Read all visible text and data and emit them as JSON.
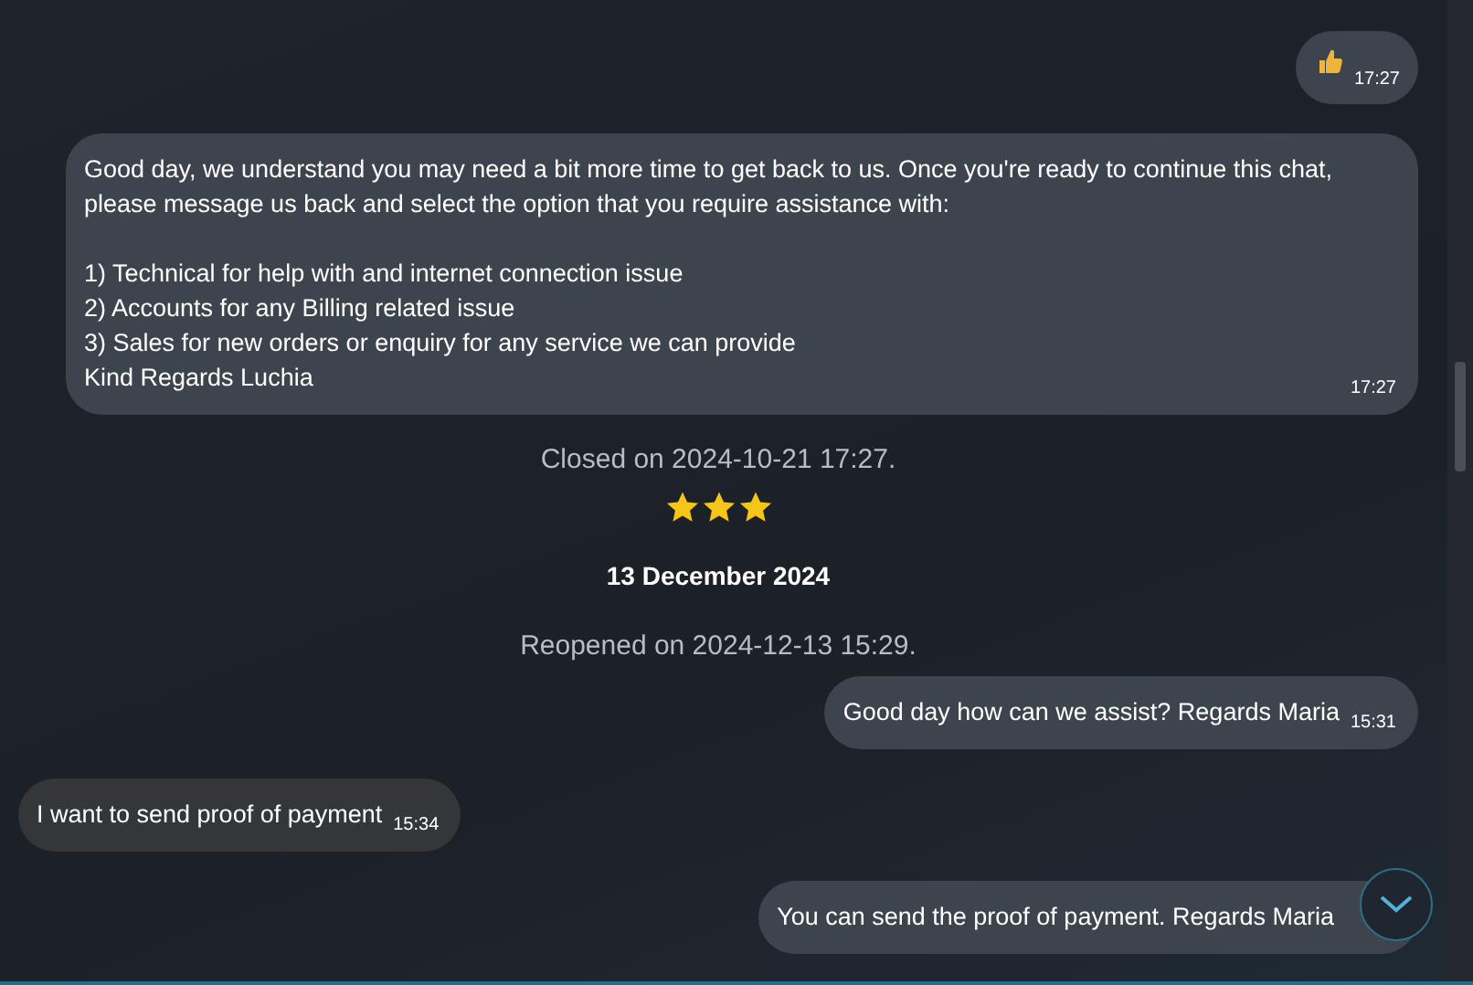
{
  "messages": [
    {
      "kind": "thumbs_up",
      "outgoing": true,
      "time": "17:27"
    },
    {
      "kind": "text",
      "outgoing": true,
      "text": "Good day, we understand you may need a bit more time to get back to us. Once you're ready to continue this chat, please message us back and select the option that you require assistance with:\n\n1) Technical for help with and internet connection issue\n2) Accounts for any Billing related issue\n3) Sales for new orders or enquiry for any service we can provide\nKind Regards Luchia",
      "time": "17:27"
    },
    {
      "kind": "system",
      "text": "Closed on 2024-10-21 17:27."
    },
    {
      "kind": "rating",
      "stars": 3
    },
    {
      "kind": "date",
      "text": "13 December 2024"
    },
    {
      "kind": "system",
      "text": "Reopened on 2024-12-13 15:29."
    },
    {
      "kind": "text",
      "outgoing": true,
      "text": "Good day how can we assist? Regards Maria",
      "time": "15:31"
    },
    {
      "kind": "text",
      "outgoing": false,
      "text": "I want to send proof of payment",
      "time": "15:34"
    },
    {
      "kind": "text",
      "outgoing": true,
      "text": "You can send the proof of payment. Regards Maria"
    }
  ]
}
